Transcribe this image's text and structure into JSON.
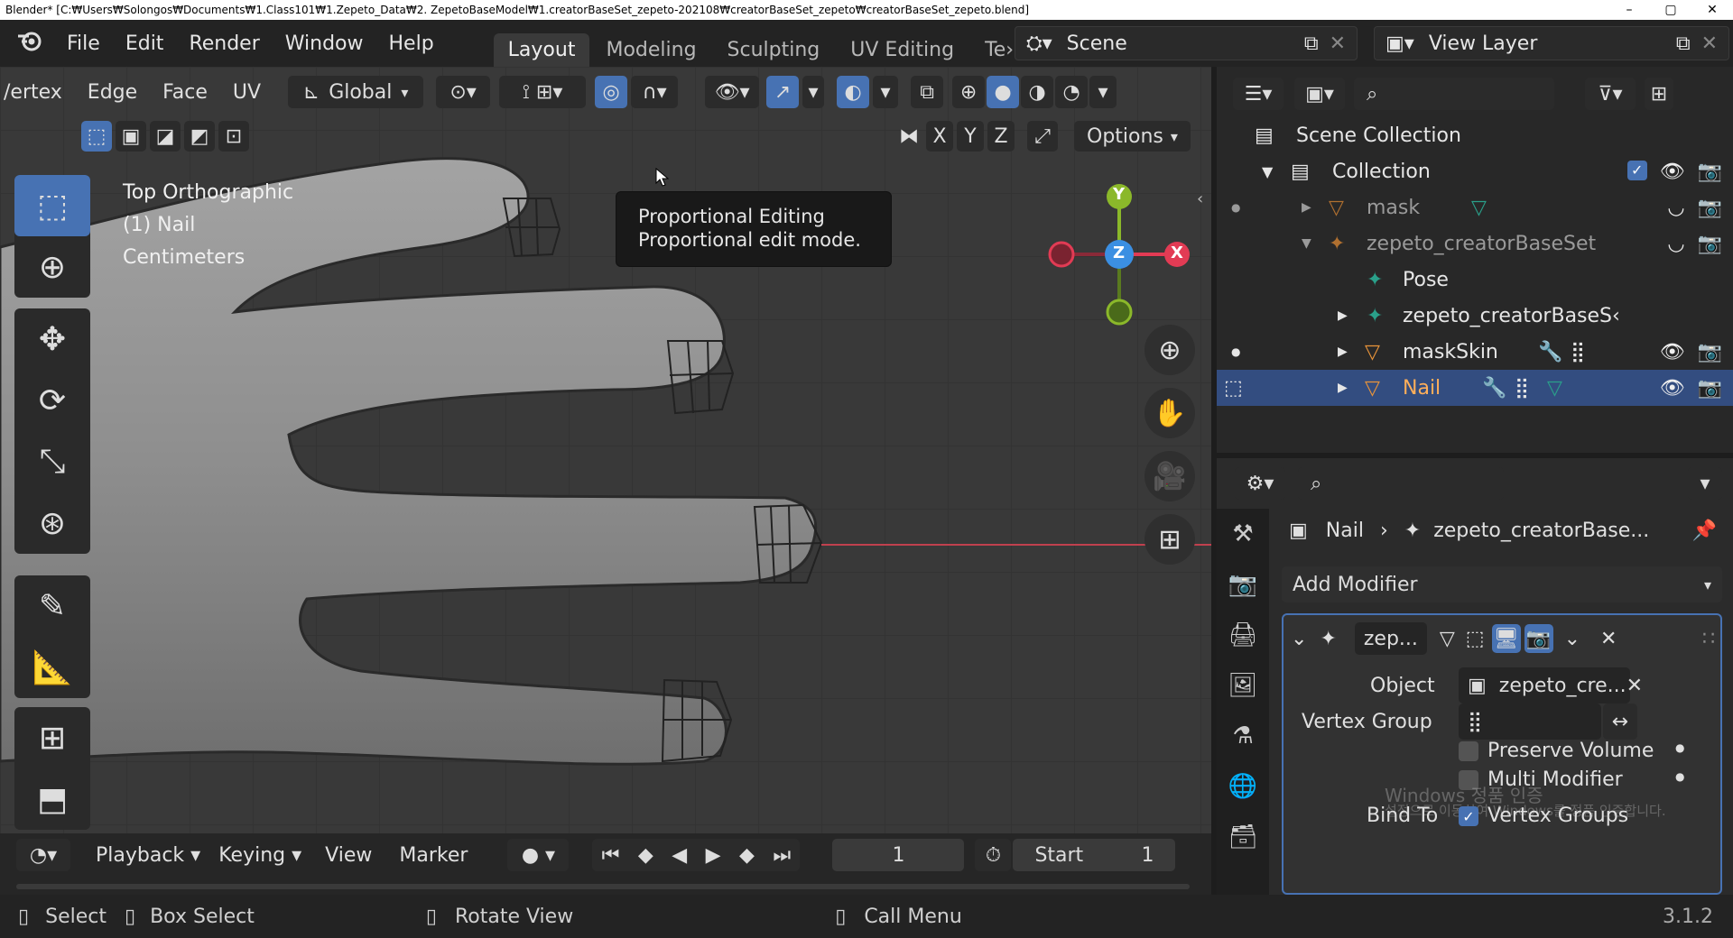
{
  "window": {
    "title": "Blender* [C:₩Users₩Solongos₩Documents₩1.Class101₩1.Zepeto_Data₩2. ZepetoBaseModel₩1.creatorBaseSet_zepeto-202108₩creatorBaseSet_zepeto₩creatorBaseSet_zepeto.blend]",
    "controls": [
      "–",
      "▢",
      "✕"
    ]
  },
  "menu": [
    "File",
    "Edit",
    "Render",
    "Window",
    "Help"
  ],
  "workspaces": [
    {
      "label": "Layout",
      "active": true
    },
    {
      "label": "Modeling"
    },
    {
      "label": "Sculpting"
    },
    {
      "label": "UV Editing"
    },
    {
      "label": "Te›"
    }
  ],
  "scene": {
    "value": "Scene"
  },
  "view_layer": {
    "value": "View Layer"
  },
  "viewport": {
    "header": {
      "mode_items": [
        "/ertex",
        "Edge",
        "Face",
        "UV"
      ],
      "transform_orientation": "Global",
      "axes": [
        "X",
        "Y",
        "Z"
      ],
      "options_label": "Options"
    },
    "info": {
      "view": "Top Orthographic",
      "object": "(1) Nail",
      "units": "Centimeters"
    },
    "tooltip": {
      "title": "Proportional Editing",
      "desc": "Proportional edit mode."
    },
    "gizmo": {
      "y": "Y",
      "z": "Z",
      "x": "X"
    }
  },
  "timeline": {
    "menus": [
      "Playback",
      "Keying",
      "View",
      "Marker"
    ],
    "current_frame": "1",
    "start_label": "Start",
    "start_value": "1"
  },
  "statusbar": {
    "select": "Select",
    "box_select": "Box Select",
    "rotate_view": "Rotate View",
    "call_menu": "Call Menu",
    "version": "3.1.2"
  },
  "outliner": {
    "rows": [
      {
        "label": "Scene Collection"
      },
      {
        "label": "Collection"
      },
      {
        "label": "mask"
      },
      {
        "label": "zepeto_creatorBaseSet"
      },
      {
        "label": "Pose"
      },
      {
        "label": "zepeto_creatorBaseS‹"
      },
      {
        "label": "maskSkin"
      },
      {
        "label": "Nail",
        "selected": true
      }
    ]
  },
  "properties": {
    "breadcrumb": {
      "object": "Nail",
      "modifier_target": "zepeto_creatorBase..."
    },
    "add_modifier": "Add Modifier",
    "modifier": {
      "name": "zep...",
      "object_label": "Object",
      "object_value": "zepeto_cre...",
      "vertex_group_label": "Vertex Group",
      "preserve_volume": "Preserve Volume",
      "multi_modifier": "Multi Modifier",
      "bind_to": "Bind To",
      "vertex_groups": "Vertex Groups"
    },
    "watermark": {
      "line1": "Windows 정품 인증",
      "line2": "설정으로 이동하여 Windows를 정품 인증합니다."
    }
  },
  "colors": {
    "accent": "#4772b3",
    "selection": "#334d80",
    "axis_x": "#e23b54",
    "axis_y": "#8bb82a",
    "axis_z": "#3b8fe2",
    "object_orange": "#e8943a"
  }
}
